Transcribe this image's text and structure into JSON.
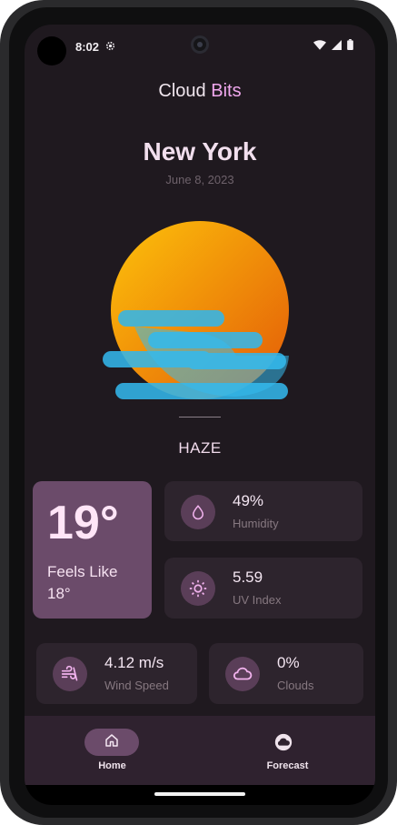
{
  "status_bar": {
    "time": "8:02"
  },
  "app": {
    "title_part1": "Cloud",
    "title_part2": "Bits"
  },
  "location": {
    "city": "New York",
    "date": "June 8, 2023"
  },
  "weather": {
    "condition": "HAZE",
    "temperature": "19°",
    "feels_like_label": "Feels Like",
    "feels_like_value": "18°"
  },
  "metrics": [
    {
      "value": "49%",
      "label": "Humidity",
      "icon": "droplet-icon"
    },
    {
      "value": "5.59",
      "label": "UV Index",
      "icon": "sun-icon"
    },
    {
      "value": "4.12 m/s",
      "label": "Wind Speed",
      "icon": "wind-icon"
    },
    {
      "value": "0%",
      "label": "Clouds",
      "icon": "cloud-icon"
    }
  ],
  "nav": [
    {
      "label": "Home",
      "icon": "home-icon",
      "selected": true
    },
    {
      "label": "Forecast",
      "icon": "forecast-icon",
      "selected": false
    }
  ],
  "colors": {
    "background": "#1f191f",
    "accent": "#f0a8ee",
    "card": "#2d242d",
    "highlight_card": "#6b4b6a",
    "icon_circle": "#5a3e58"
  }
}
